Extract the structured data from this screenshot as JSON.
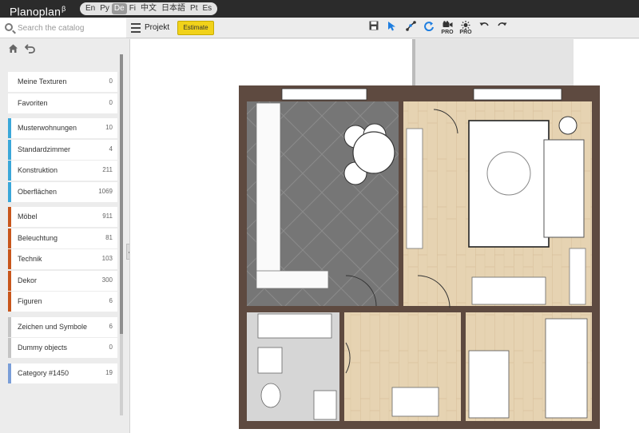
{
  "app": {
    "name": "Planoplan",
    "beta_mark": "β"
  },
  "languages": [
    {
      "code": "En",
      "active": false
    },
    {
      "code": "Py",
      "active": false
    },
    {
      "code": "De",
      "active": true
    },
    {
      "code": "Fi",
      "active": false
    },
    {
      "code": "中文",
      "active": false
    },
    {
      "code": "日本語",
      "active": false
    },
    {
      "code": "Pt",
      "active": false
    },
    {
      "code": "Es",
      "active": false
    }
  ],
  "search": {
    "placeholder": "Search the catalog",
    "icon": "search-icon"
  },
  "sidebar_nav": {
    "home_icon": "home-icon",
    "back_icon": "back-arrow-icon"
  },
  "categories": [
    {
      "label": "Meine Texturen",
      "count": "0",
      "color": "#ffffff",
      "group": 1
    },
    {
      "label": "Favoriten",
      "count": "0",
      "color": "#ffffff",
      "group": 1
    },
    {
      "label": "Musterwohnungen",
      "count": "10",
      "color": "#3aa7d9",
      "group": 2
    },
    {
      "label": "Standardzimmer",
      "count": "4",
      "color": "#3aa7d9",
      "group": 2
    },
    {
      "label": "Konstruktion",
      "count": "211",
      "color": "#3aa7d9",
      "group": 2
    },
    {
      "label": "Oberflächen",
      "count": "1069",
      "color": "#3aa7d9",
      "group": 2
    },
    {
      "label": "Möbel",
      "count": "911",
      "color": "#c8561c",
      "group": 3
    },
    {
      "label": "Beleuchtung",
      "count": "81",
      "color": "#c8561c",
      "group": 3
    },
    {
      "label": "Technik",
      "count": "103",
      "color": "#c8561c",
      "group": 3
    },
    {
      "label": "Dekor",
      "count": "300",
      "color": "#c8561c",
      "group": 3
    },
    {
      "label": "Figuren",
      "count": "6",
      "color": "#c8561c",
      "group": 3
    },
    {
      "label": "Zeichen und Symbole",
      "count": "6",
      "color": "#c4c4c4",
      "group": 4
    },
    {
      "label": "Dummy objects",
      "count": "0",
      "color": "#c4c4c4",
      "group": 4
    },
    {
      "label": "Category #1450",
      "count": "19",
      "color": "#7a9ed8",
      "group": 5
    }
  ],
  "toolbar": {
    "menu_icon": "hamburger-menu-icon",
    "project_label": "Projekt",
    "estimate_label": "Estimate",
    "tools": [
      {
        "name": "save-icon",
        "pro": ""
      },
      {
        "name": "select-cursor-icon",
        "pro": ""
      },
      {
        "name": "measure-line-icon",
        "pro": ""
      },
      {
        "name": "rotate-icon",
        "pro": ""
      },
      {
        "name": "video-camera-icon",
        "pro": "PRO"
      },
      {
        "name": "light-sun-icon",
        "pro": "PRO"
      },
      {
        "name": "undo-icon",
        "pro": ""
      },
      {
        "name": "redo-icon",
        "pro": ""
      }
    ]
  },
  "colors": {
    "topbar": "#2b2b2b",
    "accent_yellow": "#f1d21a",
    "wall": "#5e4a40",
    "wood_floor": "#e3cfae",
    "tile_floor": "#777777",
    "bath_floor": "#d2d2d2"
  }
}
